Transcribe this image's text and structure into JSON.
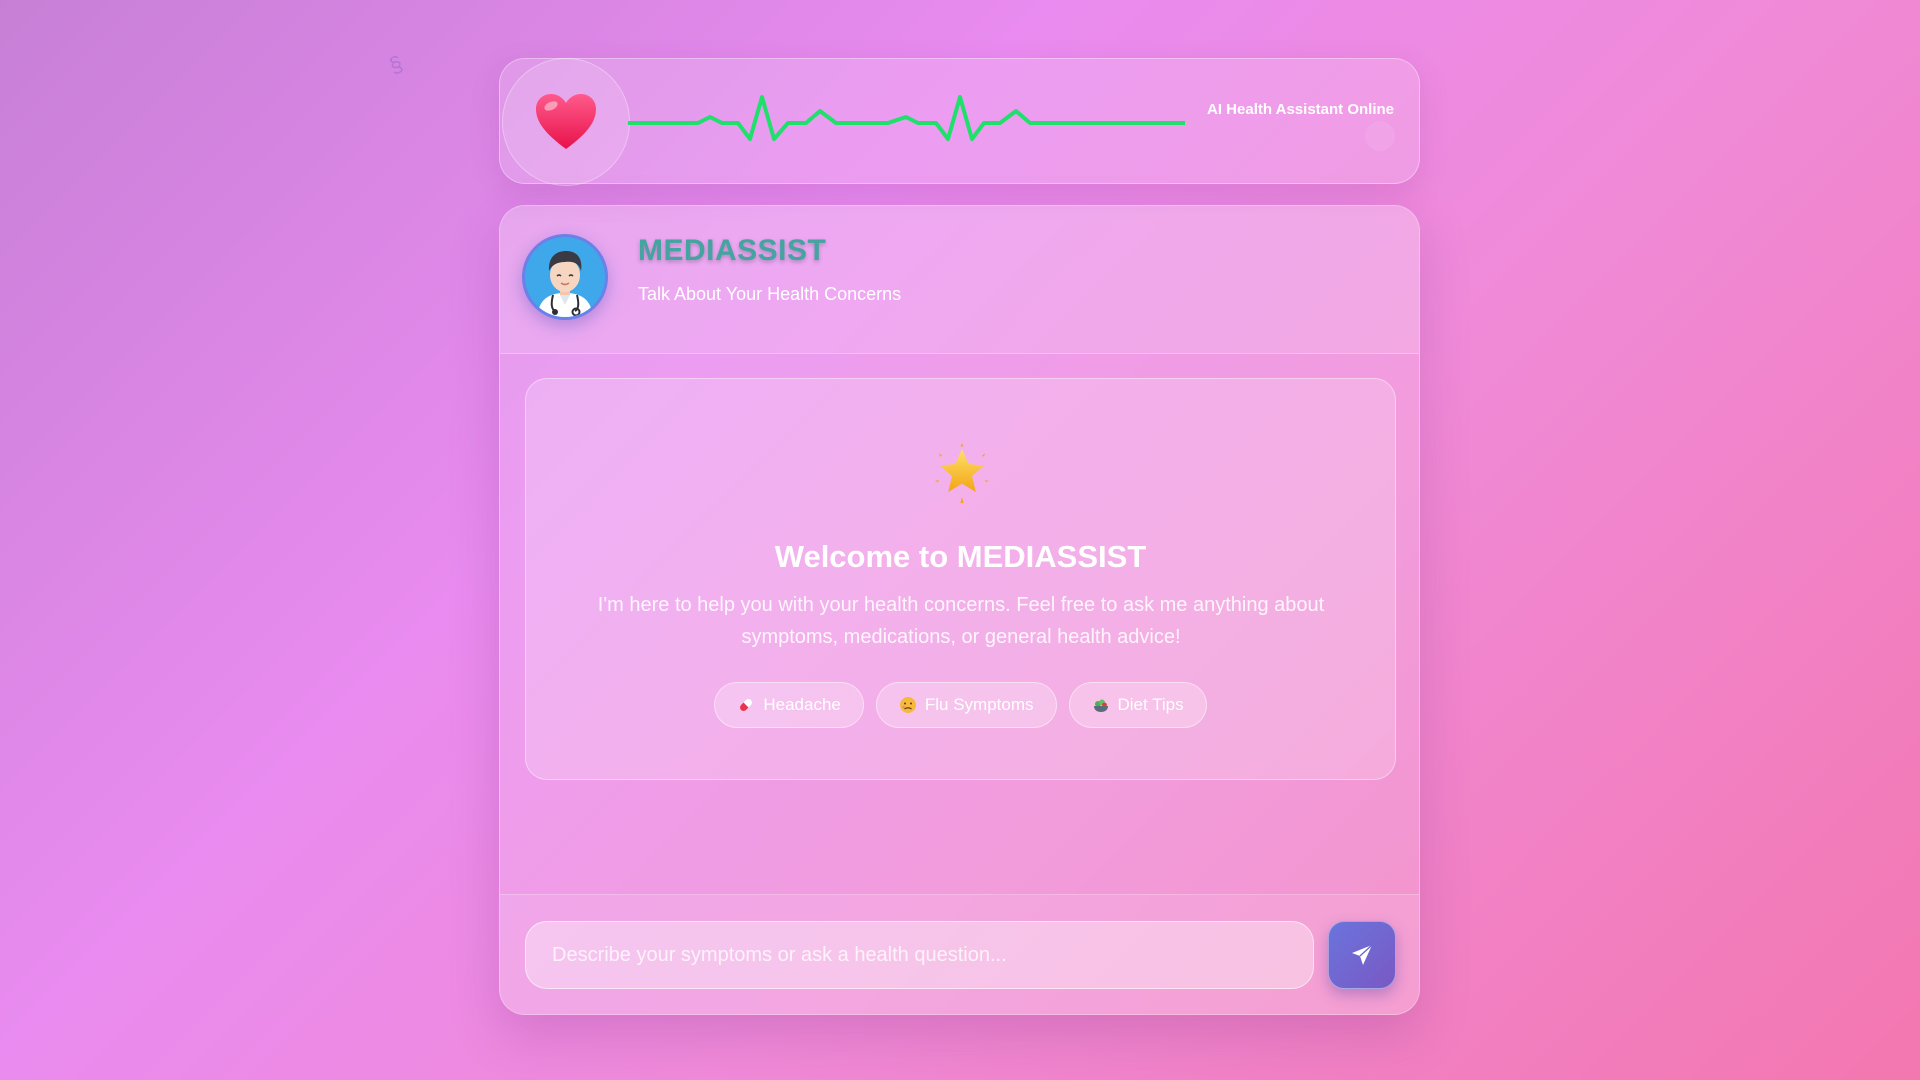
{
  "monitor": {
    "status_text": "AI Health Assistant Online",
    "heart_icon": "heart-icon",
    "heartbeat_color": "#1ee06a"
  },
  "header": {
    "title": "MEDIASSIST",
    "subtitle": "Talk About Your Health Concerns",
    "avatar_icon": "doctor-avatar"
  },
  "welcome": {
    "icon": "star-icon",
    "title": "Welcome to MEDIASSIST",
    "text": "I'm here to help you with your health concerns. Feel free to ask me anything about symptoms, medications, or general health advice!"
  },
  "suggestions": [
    {
      "icon": "pill-icon",
      "label": "Headache"
    },
    {
      "icon": "sick-face-icon",
      "label": "Flu Symptoms"
    },
    {
      "icon": "salad-icon",
      "label": "Diet Tips"
    }
  ],
  "input": {
    "placeholder": "Describe your symptoms or ask a health question...",
    "value": ""
  },
  "send_button": {
    "icon": "send-icon"
  },
  "colors": {
    "accent": "#6a74dc",
    "brand_title": "#45a3a0",
    "heartbeat": "#1ee06a"
  }
}
